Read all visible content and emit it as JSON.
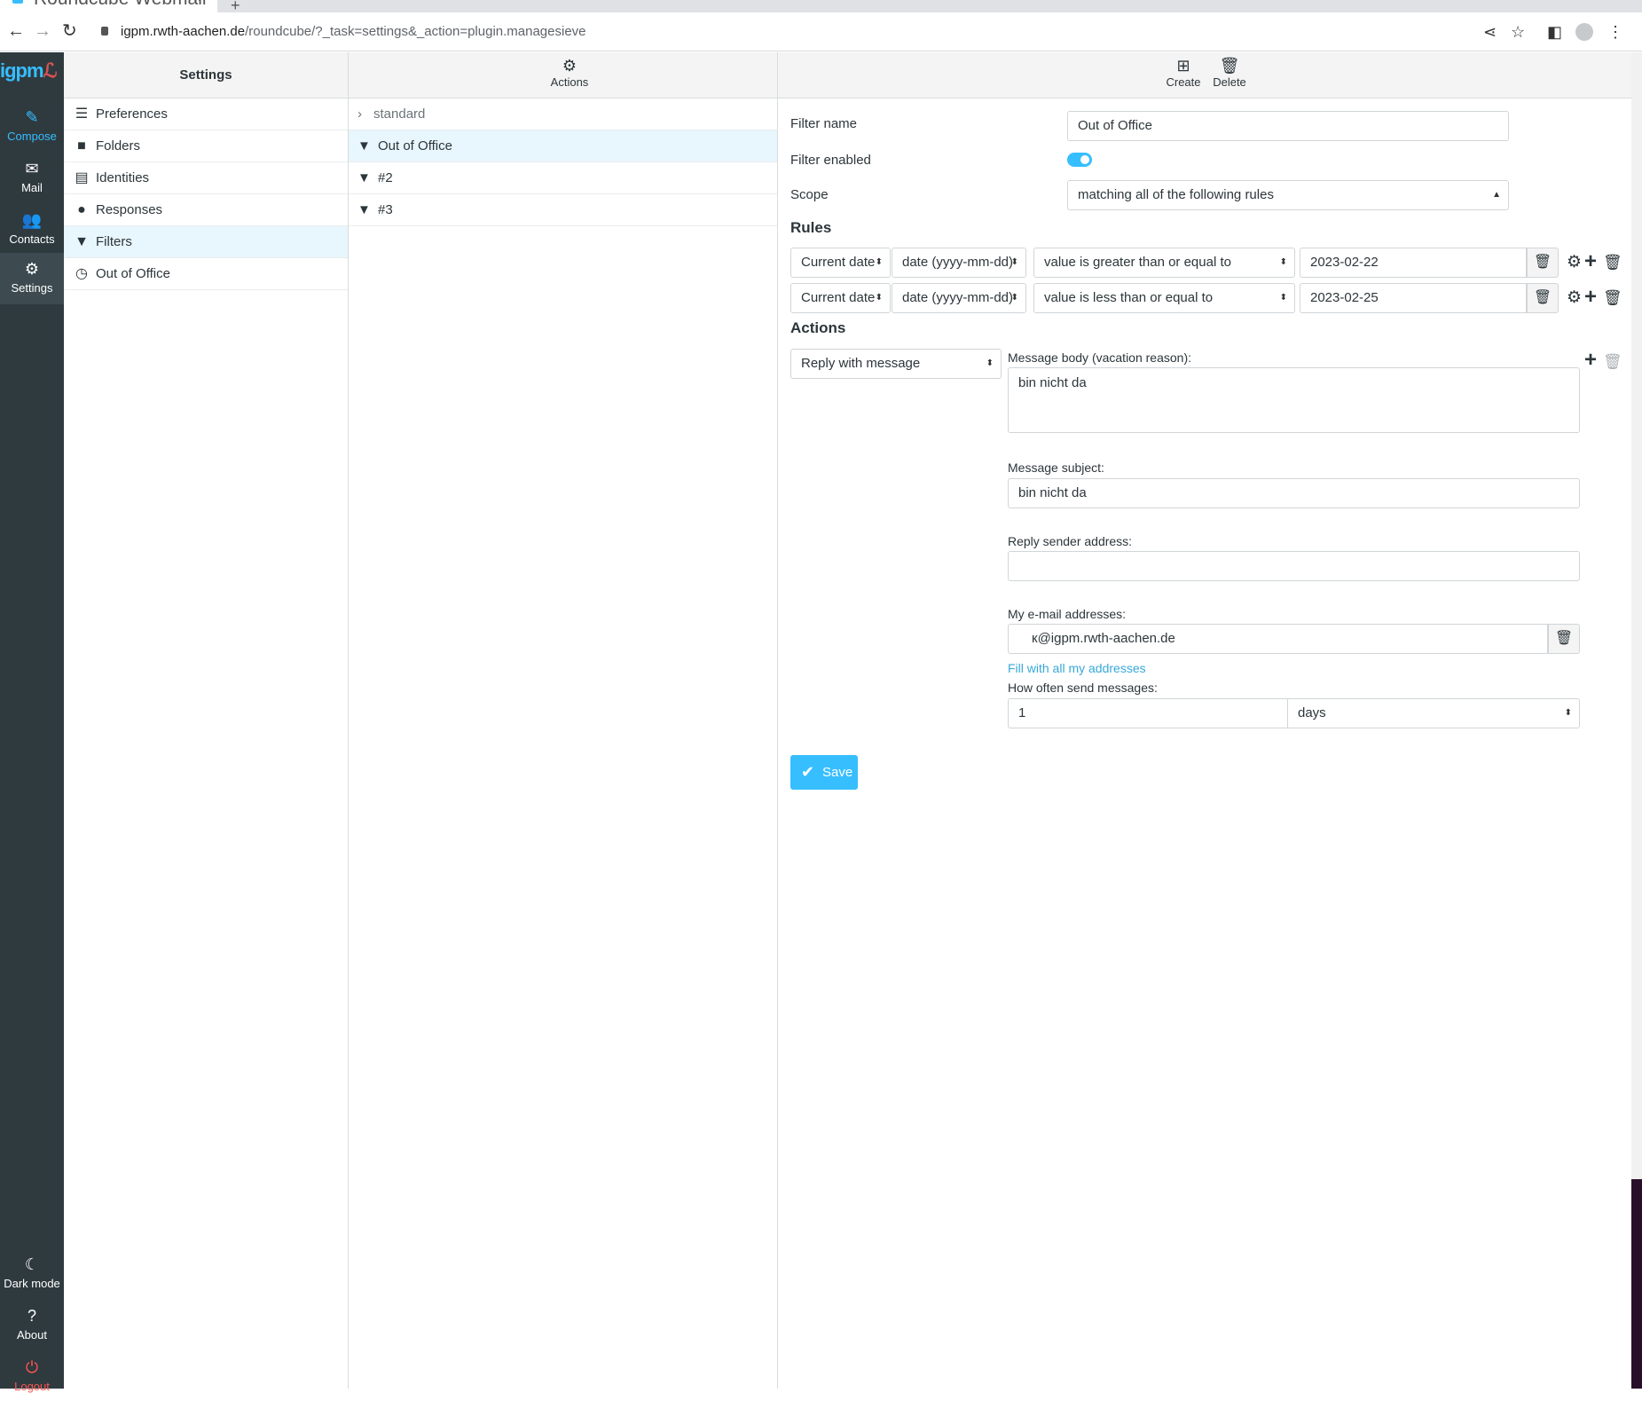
{
  "browser": {
    "tab_title": "Roundcube Webmail",
    "url_domain": "igpm.rwth-aachen.de",
    "url_path": "/roundcube/?_task=settings&_action=plugin.managesieve"
  },
  "sidebar": {
    "logo": "igpm",
    "items": [
      {
        "label": "Compose",
        "icon": "compose-icon"
      },
      {
        "label": "Mail",
        "icon": "envelope-icon"
      },
      {
        "label": "Contacts",
        "icon": "users-icon"
      },
      {
        "label": "Settings",
        "icon": "gear-icon"
      }
    ],
    "bottom": [
      {
        "label": "Dark mode",
        "icon": "moon-icon"
      },
      {
        "label": "About",
        "icon": "question-icon"
      },
      {
        "label": "Logout",
        "icon": "power-icon"
      }
    ]
  },
  "settings_panel": {
    "title": "Settings",
    "items": [
      {
        "label": "Preferences",
        "icon": "sliders-icon"
      },
      {
        "label": "Folders",
        "icon": "folder-icon"
      },
      {
        "label": "Identities",
        "icon": "id-card-icon"
      },
      {
        "label": "Responses",
        "icon": "comment-icon"
      },
      {
        "label": "Filters",
        "icon": "filter-icon"
      },
      {
        "label": "Out of Office",
        "icon": "clock-icon"
      }
    ]
  },
  "filters_panel": {
    "actions_label": "Actions",
    "filter_set": "standard",
    "filters": [
      "Out of Office",
      "#2",
      "#3"
    ]
  },
  "toolbar": {
    "create_label": "Create",
    "delete_label": "Delete"
  },
  "form": {
    "filter_name_label": "Filter name",
    "filter_name_value": "Out of Office",
    "filter_enabled_label": "Filter enabled",
    "filter_enabled": true,
    "scope_label": "Scope",
    "scope_value": "matching all of the following rules",
    "rules_heading": "Rules",
    "rules": [
      {
        "header": "Current date",
        "type": "date (yyyy-mm-dd)",
        "operator": "value is greater than or equal to",
        "value": "2023-02-22"
      },
      {
        "header": "Current date",
        "type": "date (yyyy-mm-dd)",
        "operator": "value is less than or equal to",
        "value": "2023-02-25"
      }
    ],
    "actions_heading": "Actions",
    "action_type": "Reply with message",
    "body_label": "Message body (vacation reason):",
    "body_value": "bin nicht da",
    "subject_label": "Message subject:",
    "subject_value": "bin nicht da",
    "sender_label": "Reply sender address:",
    "sender_value": "",
    "addresses_label": "My e-mail addresses:",
    "address_value": "к@igpm.rwth-aachen.de",
    "fill_link": "Fill with all my addresses",
    "how_often_label": "How often send messages:",
    "how_often_value": "1",
    "how_often_unit": "days",
    "save_label": "Save"
  },
  "colors": {
    "accent": "#37beff",
    "sidebar_bg": "#2f3a3f",
    "logout": "#ff5552",
    "selected_row": "#e8f6fd"
  }
}
